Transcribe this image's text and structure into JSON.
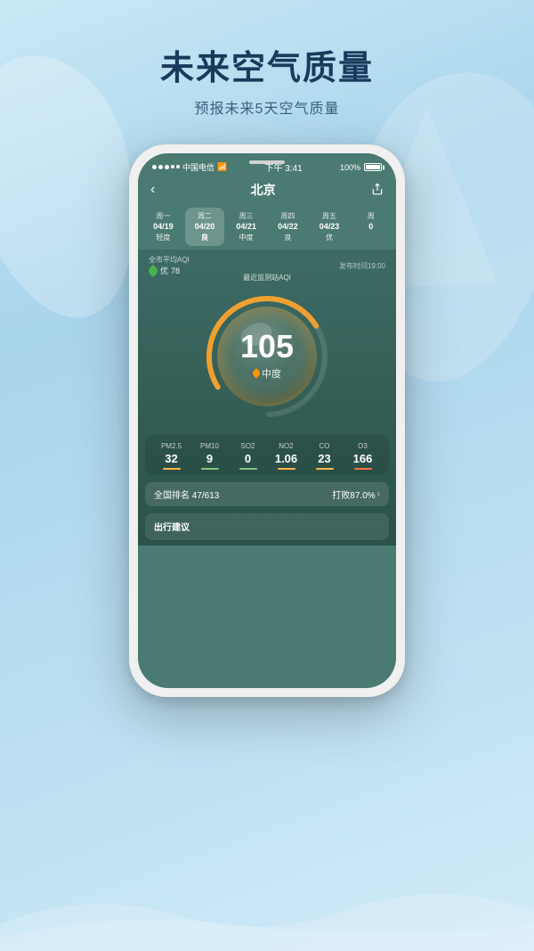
{
  "background": {
    "gradient_start": "#c8e8f5",
    "gradient_end": "#d0eaf8"
  },
  "header": {
    "title": "未来空气质量",
    "subtitle": "预报未来5天空气质量"
  },
  "phone": {
    "status_bar": {
      "carrier": "中国电信",
      "wifi_icon": "wifi",
      "time": "下午 3:41",
      "battery": "100%"
    },
    "nav": {
      "back_label": "‹",
      "title": "北京",
      "share_icon": "share"
    },
    "days": [
      {
        "week": "周一",
        "date": "04/19",
        "quality": "轻度",
        "active": false
      },
      {
        "week": "周二",
        "date": "04/20",
        "quality": "良",
        "active": true
      },
      {
        "week": "周三",
        "date": "04/21",
        "quality": "中度",
        "active": false
      },
      {
        "week": "周四",
        "date": "04/22",
        "quality": "良",
        "active": false
      },
      {
        "week": "周五",
        "date": "04/23",
        "quality": "优",
        "active": false
      },
      {
        "week": "周",
        "date": "0",
        "quality": "",
        "active": false
      }
    ],
    "city_avg": {
      "label": "全市平均AQI",
      "quality": "优",
      "value": "78",
      "publish": "发布时间19:00"
    },
    "gauge": {
      "label": "最近监测站AQI",
      "value": "105",
      "quality": "中度",
      "arc_color": "#f0a030",
      "track_color": "rgba(255,255,255,0.15)"
    },
    "pollutants": [
      {
        "name": "PM2.5",
        "value": "32",
        "bar_color": "#ffb74d"
      },
      {
        "name": "PM10",
        "value": "9",
        "bar_color": "#81c784"
      },
      {
        "name": "SO2",
        "value": "0",
        "bar_color": "#81c784"
      },
      {
        "name": "NO2",
        "value": "1.06",
        "bar_color": "#ffb74d"
      },
      {
        "name": "CO",
        "value": "23",
        "bar_color": "#ffb74d"
      },
      {
        "name": "O3",
        "value": "166",
        "bar_color": "#ff7043"
      }
    ],
    "ranking": {
      "label": "全国排名",
      "value": "47/613",
      "beat_label": "打败87.0%",
      "chevron": "›"
    },
    "advice": {
      "label": "出行建议"
    }
  }
}
